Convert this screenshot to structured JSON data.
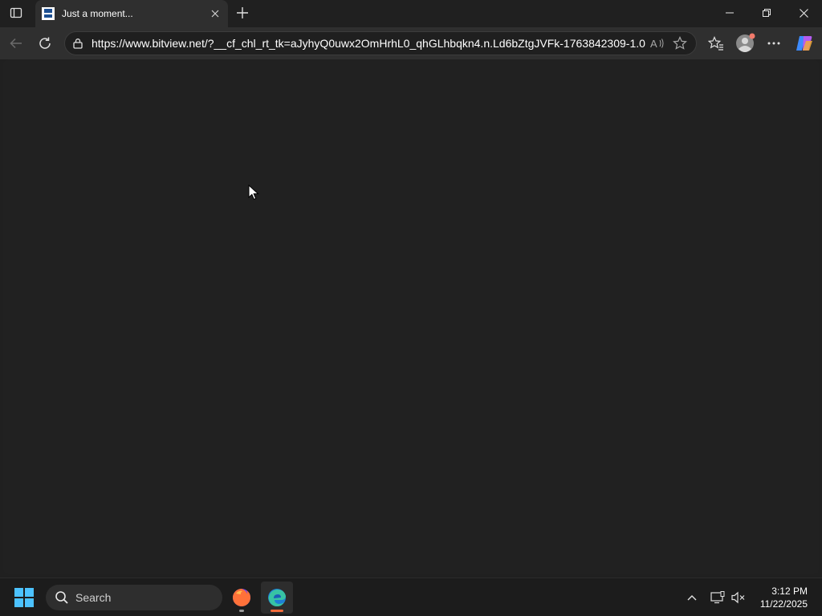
{
  "browser": {
    "tab": {
      "title": "Just a moment..."
    },
    "address_bar": {
      "url": "https://www.bitview.net/?__cf_chl_rt_tk=aJyhyQ0uwx2OmHrhL0_qhGLhbqkn4.n.Ld6bZtgJVFk-1763842309-1.0..."
    },
    "icons": {
      "tab_actions": "tab-actions-icon",
      "new_tab": "plus-icon",
      "back": "back-arrow-icon",
      "refresh": "refresh-icon",
      "lock": "lock-icon",
      "read_aloud": "read-aloud-icon",
      "favorite": "star-icon",
      "favorites": "favorites-icon",
      "profile": "profile-icon",
      "more": "more-icon",
      "copilot": "copilot-icon"
    }
  },
  "taskbar": {
    "search_label": "Search",
    "apps": [
      "firefox-icon",
      "edge-icon"
    ],
    "clock": {
      "time": "3:12 PM",
      "date": "11/22/2025"
    }
  },
  "colors": {
    "accent": "#4cc2ff",
    "edge_indicator": "#f26b3a",
    "background": "#202020"
  }
}
